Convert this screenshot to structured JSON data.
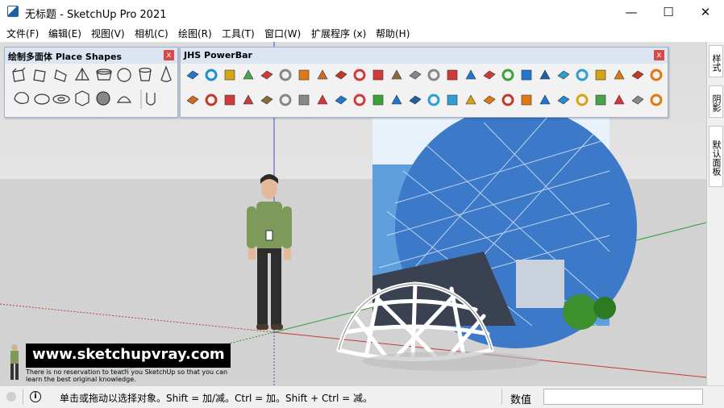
{
  "window": {
    "title": "无标题 - SketchUp Pro 2021",
    "minimize": "—",
    "maximize": "☐",
    "close": "✕"
  },
  "menu": [
    "文件(F)",
    "编辑(E)",
    "视图(V)",
    "相机(C)",
    "绘图(R)",
    "工具(T)",
    "窗口(W)",
    "扩展程序 (x)",
    "帮助(H)"
  ],
  "place_shapes": {
    "title_cn": "绘制多面体",
    "title_en": "Place Shapes",
    "close": "x",
    "tools": [
      "cube",
      "prism",
      "wedge",
      "pyramid",
      "box",
      "sphere",
      "cylinder",
      "cone",
      "torus",
      "hemisphere",
      "disc",
      "polyhedron",
      "geosphere",
      "dome",
      "tube"
    ]
  },
  "powerbar": {
    "title": "JHS PowerBar",
    "close": "x",
    "row1_count": 26,
    "row2_count": 26
  },
  "right_tabs": [
    "样式",
    "阴影",
    "默认面板"
  ],
  "watermark": {
    "url": "www.sketchupvray.com",
    "note": "There is no reservation to teach you SketchUp so that you can learn the best original knowledge."
  },
  "status": {
    "hint": "单击或拖动以选择对象。Shift = 加/减。Ctrl = 加。Shift + Ctrl = 减。",
    "measure_label": "数值",
    "measure_value": ""
  },
  "colors": {
    "axis_red": "#c53a3a",
    "axis_green": "#2f9e2f",
    "axis_blue": "#4a4ac8",
    "panel_border": "#9fb4cf"
  }
}
